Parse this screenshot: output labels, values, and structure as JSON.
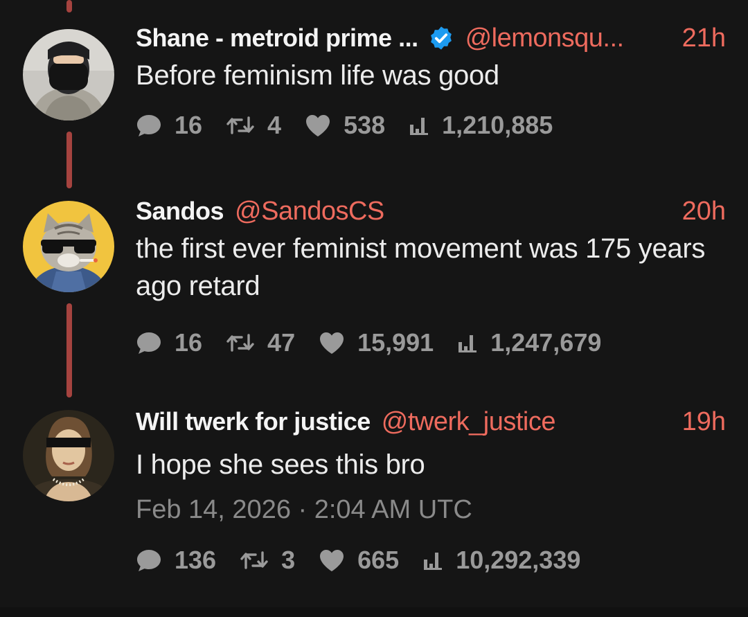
{
  "tweets": [
    {
      "name": "Shane - metroid prime ...",
      "verified": true,
      "handle": "@lemonsqu...",
      "time": "21h",
      "text": "Before feminism life was good",
      "stats": {
        "replies": "16",
        "retweets": "4",
        "likes": "538",
        "views": "1,210,885"
      }
    },
    {
      "name": "Sandos",
      "verified": false,
      "handle": "@SandosCS",
      "time": "20h",
      "text": "the first ever feminist movement was 175 years ago retard",
      "stats": {
        "replies": "16",
        "retweets": "47",
        "likes": "15,991",
        "views": "1,247,679"
      }
    },
    {
      "name": "Will twerk for justice",
      "verified": false,
      "handle": "@twerk_justice",
      "time": "19h",
      "text": "I hope she sees this bro",
      "date": "Feb 14, 2026 · 2:04 AM UTC",
      "stats": {
        "replies": "136",
        "retweets": "3",
        "likes": "665",
        "views": "10,292,339"
      }
    }
  ],
  "icons": {
    "reply": "speech-bubble-icon",
    "retweet": "retweet-arrows-icon",
    "like": "heart-icon",
    "views": "bar-chart-icon",
    "verified": "verified-badge-icon"
  },
  "colors": {
    "background": "#151515",
    "accent": "#ee6b5e",
    "thread_line": "#a5433f",
    "verified": "#1d9bf0",
    "muted": "#9a9a9a"
  }
}
